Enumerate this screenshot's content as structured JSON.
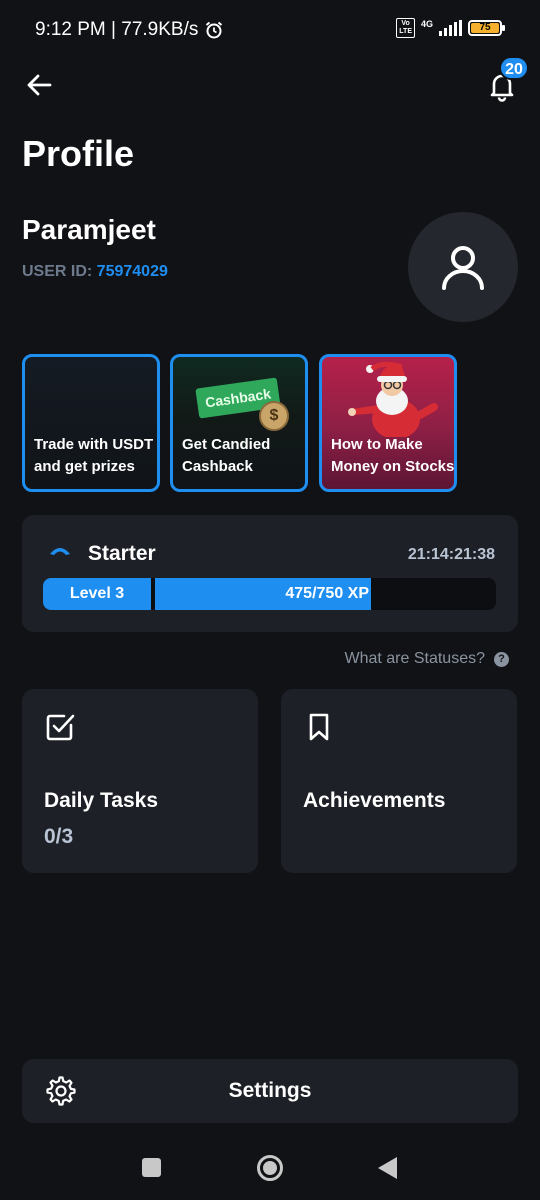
{
  "status_bar": {
    "time_speed": "9:12 PM | 77.9KB/s",
    "volte": "Vo\nLTE",
    "network": "4G",
    "battery": "75"
  },
  "header": {
    "notification_count": "20",
    "title": "Profile"
  },
  "user": {
    "name": "Paramjeet",
    "id_label": "USER ID: ",
    "id_value": "75974029"
  },
  "promos": [
    {
      "label": "Trade with USDT and get prizes"
    },
    {
      "label": "Get Candied Cashback",
      "tag": "Cashback",
      "coin": "$"
    },
    {
      "label": "How to Make Money on Stocks"
    }
  ],
  "status": {
    "name": "Starter",
    "timer": "21:14:21:38",
    "level": "Level 3",
    "xp_text": "475/750 XP",
    "xp_current": 475,
    "xp_total": 750
  },
  "statuses_link": "What are Statuses?",
  "help_icon": "?",
  "tiles": {
    "daily_tasks": {
      "title": "Daily Tasks",
      "count": "0/3"
    },
    "achievements": {
      "title": "Achievements"
    }
  },
  "settings": {
    "label": "Settings"
  },
  "colors": {
    "accent": "#1f8ef1",
    "background": "#111216",
    "card": "#1d2026"
  },
  "icons": {
    "back": "arrow-left-icon",
    "bell": "bell-icon",
    "avatar": "user-icon",
    "status": "chevron-rank-icon",
    "tasks": "checkbox-icon",
    "achievements": "bookmark-icon",
    "settings": "gear-icon"
  }
}
